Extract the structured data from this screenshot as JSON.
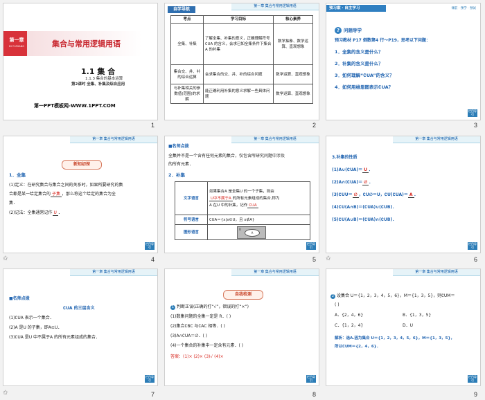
{
  "header_tag": "第一章  集合与常用逻辑用语",
  "back_label": "栏目导引",
  "slide_numbers": [
    "1",
    "2",
    "3",
    "4",
    "5",
    "6",
    "7",
    "8",
    "9"
  ],
  "slide1": {
    "chapter_tag": "第一章",
    "chapter_pinyin": "DI YI ZHANG",
    "title": "集合与常用逻辑用语",
    "section": "1.1  集  合",
    "subsection": "1.1.3  集合的基本运算",
    "lesson": "第2课时  全集、补集及综合应用",
    "footer": "第一PPT模板网-WWW.1PPT.COM"
  },
  "slide2": {
    "banner": "自学导航",
    "headers": [
      "考点",
      "学习目标",
      "核心素养"
    ],
    "rows": [
      [
        "全集、补集",
        "了解全集、补集的意义，正确理解符号∁UA 的含义，会求已知全集条件下集合A 的补集",
        "数学抽象、数学运算、直观想象"
      ],
      [
        "集合交、并、补的综合运算",
        "会求集合的交、并、补的综合问题",
        "数学运算、直观想象"
      ],
      [
        "与补集相关的参数值(范围)的求解",
        "能正确利用补集的意义求解一些具体问题",
        "数学运算、直观想象"
      ]
    ]
  },
  "slide3": {
    "banner": "预习案 · 自主学习",
    "top_links": "课前 · 预学 · 预试",
    "question_title": "问题导学",
    "intro": "预习教材 P17 倒数第4 行～P19，思考以下问题：",
    "questions": [
      "1．全集的含义是什么？",
      "2．补集的含义是什么？",
      "3．如何理解“∁UA”的含义？",
      "4．如何用维恩图表示∁UA？"
    ]
  },
  "slide4": {
    "pill": "新知初探",
    "h1": "1．全集",
    "p1_line1": "(1)定义：在研究集合与集合之间的关系时，如果所要研究的集",
    "p1_line2_pre": "合都是某一给定集合的",
    "p1_answer": "子集",
    "p1_line2_post": "，那么称这个给定的集合为全",
    "p1_line3": "集．",
    "p2_pre": "(2)记法：全集通常记作",
    "p2_answer": "U",
    "p2_post": "．"
  },
  "slide5": {
    "label": "■名师点拨",
    "note_line1": "全集并不是一个含有任何元素的集合，仅包含所研究问题中涉及",
    "note_line2": "的所有元素．",
    "h2": "2．补集",
    "row_labels": [
      "文字语言",
      "符号语言",
      "图形语言"
    ],
    "text_line1": "如果集合A 是全集U 的一个子集，则由",
    "text_answer": "U中不属于A",
    "text_line2_post": "的所有元素组成的集合,称为",
    "text_line3_pre": "A 在U 中的补集，记作",
    "text_answer2": "∁UA",
    "symbol": "∁UA＝{x|x∈U，且 x∉A}",
    "diagram_U": "U",
    "diagram_A": "A"
  },
  "slide6": {
    "h": "3.补集的性质",
    "lines": [
      {
        "pre": "(1)A∪(∁UA)＝",
        "ans": "U",
        "post": "．"
      },
      {
        "pre": "(2)A∩(∁UA)＝",
        "ans": "∅",
        "post": "．"
      },
      {
        "pre": "(3)∁UU＝",
        "ans": "∅",
        "post": "，∁U∅＝U，∁U(∁UA)＝",
        "ans2": "A",
        "post2": "．"
      },
      {
        "pre": "(4)∁U(A∩B)＝(∁UA)∪(∁UB)．",
        "ans": "",
        "post": ""
      },
      {
        "pre": "(5)∁U(A∪B)＝(∁UA)∩(∁UB)．",
        "ans": "",
        "post": ""
      }
    ]
  },
  "slide7": {
    "label": "■名师点拨",
    "title": "∁UA 的三层含义",
    "lines": [
      "(1)∁UA 表示一个集合．",
      "(2)A 是U 的子集，即A⊆U．",
      "(3)∁UA 是U 中不属于A 的所有元素组成的集合．"
    ]
  },
  "slide8": {
    "pill": "自我检测",
    "q1": "判断正误(正确的打“√”，错误的打“×”)",
    "items": [
      "(1)数集问题的全集一定是 R．(      )",
      "(2)集合∁BC 与∁AC 相等．(      )",
      "(3)A∩∁UA＝∅．(      )",
      "(4)一个集合的补集中一定含有元素．(      )"
    ],
    "answer": "答案：(1)×  (2)×  (3)√  (4)×"
  },
  "slide9": {
    "q_num": "2",
    "q": "设集合 U＝{1，2，3，4，5，6}，M＝{1，3，5}，则∁UM＝",
    "q_end": "(      )",
    "options": [
      "A．{2，4，6}",
      "B．{1，3，5}",
      "C．{1，2，4}",
      "D．U"
    ],
    "solution_line1": "解析：选A.因为集合 U＝{1，2，3，4，5，6}，M＝{1，3，5}，",
    "solution_line2": "所以∁UM＝{2，4，6}．"
  }
}
